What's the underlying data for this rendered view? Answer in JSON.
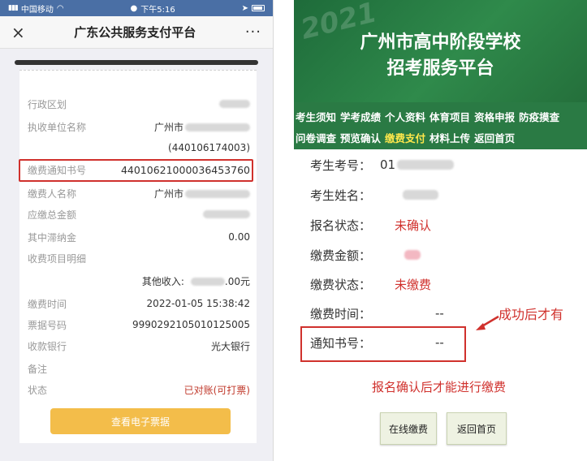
{
  "left": {
    "status": {
      "carrier": "中国移动",
      "time": "下午5:16"
    },
    "navbar": {
      "title": "广东公共服务支付平台",
      "close": "×",
      "more": "···"
    },
    "fields": {
      "region_label": "行政区划",
      "unit_label": "执收单位名称",
      "unit_value": "广州市",
      "unit_code": "(440106174003)",
      "notice_label": "缴费通知书号",
      "notice_value": "44010621000036453760",
      "payer_label": "缴费人名称",
      "payer_value": "广州市",
      "total_label": "应缴总金额",
      "late_label": "其中滞纳金",
      "late_value": "0.00",
      "items_label": "收费项目明细",
      "other_label": "其他收入:",
      "other_value_suffix": ".00元",
      "time_label": "缴费时间",
      "time_value": "2022-01-05 15:38:42",
      "bill_label": "票据号码",
      "bill_value": "9990292105010125005",
      "bank_label": "收款银行",
      "bank_value": "光大银行",
      "remark_label": "备注",
      "state_label": "状态",
      "state_value": "已对账(可打票)"
    },
    "button": "查看电子票据"
  },
  "right": {
    "watermark": "2021",
    "title_line1": "广州市高中阶段学校",
    "title_line2": "招考服务平台",
    "menu_row1": [
      "考生须知",
      "学考成绩",
      "个人资料",
      "体育项目",
      "资格申报",
      "防疫摸查"
    ],
    "menu_row2": [
      "问卷调查",
      "预览确认",
      "缴费支付",
      "材料上传",
      "返回首页"
    ],
    "active_menu": "缴费支付",
    "fields": {
      "exam_no_label": "考生考号：",
      "exam_no_value": "01",
      "name_label": "考生姓名：",
      "reg_state_label": "报名状态：",
      "reg_state_value": "未确认",
      "amount_label": "缴费金额：",
      "pay_state_label": "缴费状态：",
      "pay_state_value": "未缴费",
      "pay_time_label": "缴费时间：",
      "pay_time_value": "--",
      "notice_label": "通知书号：",
      "notice_value": "--"
    },
    "annotation": "成功后才有",
    "hint": "报名确认后才能进行缴费",
    "buttons": {
      "pay": "在线缴费",
      "home": "返回首页"
    }
  },
  "colors": {
    "green": "#2a7a44",
    "red": "#d0312d",
    "yellow_button": "#f3bd4a",
    "active_menu": "#ffe84b"
  }
}
